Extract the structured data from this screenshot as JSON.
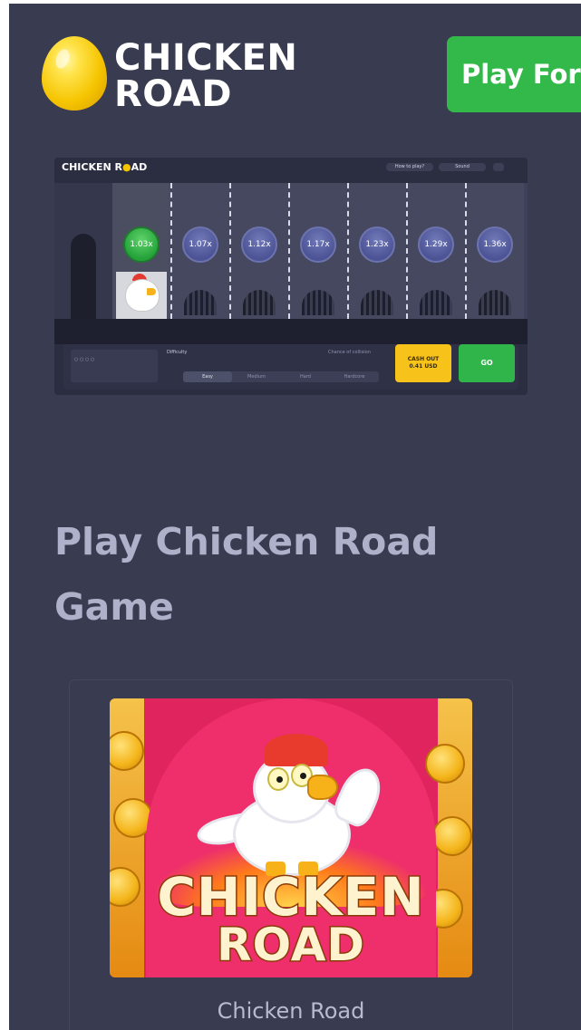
{
  "header": {
    "logo_line1": "CHICKEN",
    "logo_line2": "ROAD",
    "play_button": "Play For"
  },
  "game_preview": {
    "logo_left": "CHICKEN R",
    "logo_right": "AD",
    "how_to_play": "How to play?",
    "sound": "Sound",
    "multipliers": [
      "1.03x",
      "1.07x",
      "1.12x",
      "1.17x",
      "1.23x",
      "1.29x",
      "1.36x"
    ],
    "active_multiplier_index": 0,
    "difficulty_label": "Difficulty",
    "chance_label": "Chance of collision",
    "difficulty_options": [
      "Easy",
      "Medium",
      "Hard",
      "Hardcore"
    ],
    "selected_difficulty": "Easy",
    "cashout_line1": "CASH OUT",
    "cashout_line2": "0.41 USD",
    "go_button": "GO"
  },
  "main": {
    "heading": "Play Chicken Road Game"
  },
  "game_card": {
    "thumbnail_title_line1": "CHICKEN",
    "thumbnail_title_line2": "ROAD",
    "caption": "Chicken Road"
  },
  "colors": {
    "page_background": "#393b50",
    "play_button": "#33b94a",
    "heading_text": "#aeb1c9",
    "cashout": "#f7c21a",
    "go": "#2fb54a",
    "thumbnail_background": "#e0245e"
  },
  "icons": {
    "logo_egg": "egg-icon",
    "sound_toggle": "sound-toggle-icon",
    "menu": "menu-icon"
  }
}
